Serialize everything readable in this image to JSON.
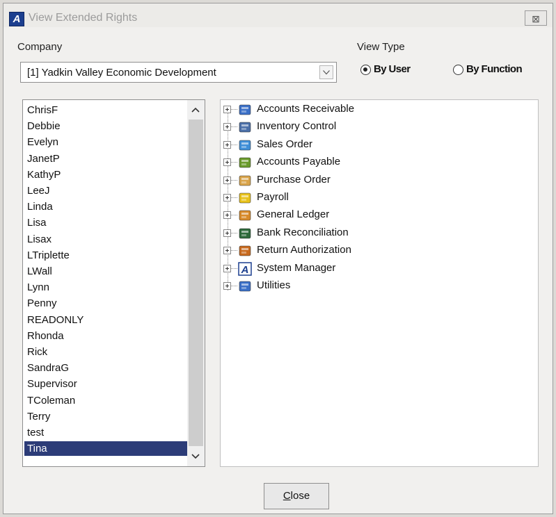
{
  "window": {
    "title": "View Extended Rights",
    "close_glyph": "⊠"
  },
  "company": {
    "label": "Company",
    "selected": "[1]   Yadkin Valley Economic Development"
  },
  "view_type": {
    "label": "View Type",
    "options": [
      {
        "label": "By User",
        "checked": true
      },
      {
        "label": "By Function",
        "checked": false
      }
    ]
  },
  "users": [
    "ChrisF",
    "Debbie",
    "Evelyn",
    "JanetP",
    "KathyP",
    "LeeJ",
    "Linda",
    "Lisa",
    "Lisax",
    "LTriplette",
    "LWall",
    "Lynn",
    "Penny",
    "READONLY",
    "Rhonda",
    "Rick",
    "SandraG",
    "Supervisor",
    "TColeman",
    "Terry",
    "test",
    "Tina"
  ],
  "selected_user": "Tina",
  "modules": [
    {
      "label": "Accounts Receivable",
      "icon": "accounts-receivable-icon",
      "color": "#3a6fc7"
    },
    {
      "label": "Inventory Control",
      "icon": "inventory-control-icon",
      "color": "#4b6fa8"
    },
    {
      "label": "Sales Order",
      "icon": "sales-order-icon",
      "color": "#3f8fd8"
    },
    {
      "label": "Accounts Payable",
      "icon": "accounts-payable-icon",
      "color": "#6a9a2a"
    },
    {
      "label": "Purchase Order",
      "icon": "purchase-order-icon",
      "color": "#d9a44a"
    },
    {
      "label": "Payroll",
      "icon": "payroll-icon",
      "color": "#e8c21a"
    },
    {
      "label": "General Ledger",
      "icon": "general-ledger-icon",
      "color": "#d88a2a"
    },
    {
      "label": "Bank Reconciliation",
      "icon": "bank-reconciliation-icon",
      "color": "#2d6a3a"
    },
    {
      "label": "Return Authorization",
      "icon": "return-authorization-icon",
      "color": "#c86a1e"
    },
    {
      "label": "System Manager",
      "icon": "system-manager-icon",
      "color": "#1c3f8f"
    },
    {
      "label": "Utilities",
      "icon": "utilities-icon",
      "color": "#3a6fc7"
    }
  ],
  "close_button": {
    "accel": "C",
    "rest": "lose"
  }
}
